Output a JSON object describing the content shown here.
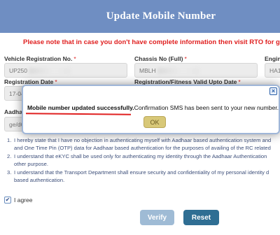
{
  "header": {
    "title": "Update Mobile Number"
  },
  "notice": "Please note that in case you don't have complete information then visit RTO for getting",
  "form": {
    "vehicle_reg_label": "Vehicle Registration No.",
    "vehicle_reg_value": "UP250",
    "chassis_label": "Chassis No (Full)",
    "chassis_value": "MBLH",
    "engine_label": "Engin",
    "engine_value": "HA1",
    "reg_date_label": "Registration Date",
    "reg_date_value": "17-04",
    "fitness_label": "Registration/Fitness Valid Upto Date",
    "aadhaar_label": "Aadhaa",
    "aadhaar_value": "ge/d6",
    "required_mark": "*"
  },
  "consent": [
    {
      "num": "1.",
      "line1": "I hereby state that I have no objection in authenticating myself with Aadhaar based authentication system and",
      "line2": "and One Time Pin (OTP) data for Aadhaar based authentication for the purposes of availing of the RC related"
    },
    {
      "num": "2.",
      "line1": "I understand that eKYC shall be used only for authenticating my identity through the Aadhaar Authentication",
      "line2": "other purpose."
    },
    {
      "num": "3.",
      "line1": "I understand that the Transport Department shall ensure security and confidentiality of my personal identity d",
      "line2": "based authentication."
    }
  ],
  "agree": {
    "label": "I agree",
    "checked": true,
    "check_glyph": "✔"
  },
  "buttons": {
    "verify": "Verify",
    "reset": "Reset"
  },
  "modal": {
    "message_bold": "Mobile number updated successfully.",
    "message_rest": "Confirmation SMS has been sent to your new number.",
    "ok": "OK",
    "close_glyph": "×"
  },
  "colors": {
    "header_bg": "#6f8ec2",
    "notice": "#e02020",
    "reset_btn": "#2f6e93",
    "verify_btn": "#9fbbd5",
    "ok_btn": "#d8c878"
  }
}
